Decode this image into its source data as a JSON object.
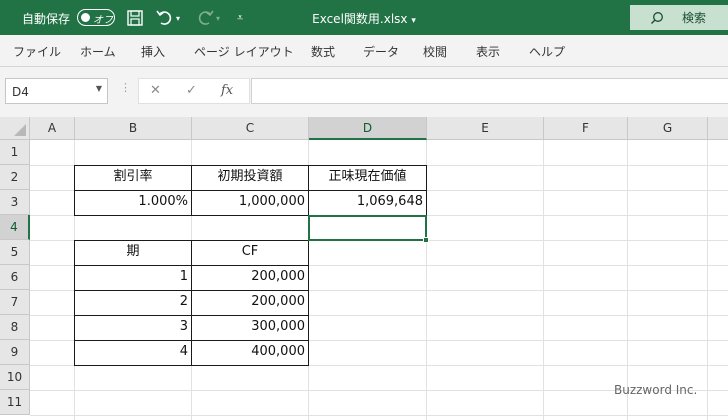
{
  "titlebar": {
    "autosave_label": "自動保存",
    "toggle_label": "オフ",
    "filename": "Excel関数用.xlsx",
    "filename_caret": "▾",
    "search_label": "検索",
    "accent": "#217346"
  },
  "ribbon": {
    "tabs": [
      "ファイル",
      "ホーム",
      "挿入",
      "ページ レイアウト",
      "数式",
      "データ",
      "校閲",
      "表示",
      "ヘルプ"
    ]
  },
  "formula_bar": {
    "name_box": "D4",
    "cancel_symbol": "✕",
    "enter_symbol": "✓",
    "fx_label": "fx",
    "formula": ""
  },
  "sheet": {
    "columns": [
      "A",
      "B",
      "C",
      "D",
      "E",
      "F",
      "G"
    ],
    "rows": [
      "1",
      "2",
      "3",
      "4",
      "5",
      "6",
      "7",
      "8",
      "9",
      "10",
      "11"
    ],
    "selected_cell": "D4",
    "table1_headers": [
      "割引率",
      "初期投資額",
      "正味現在価値"
    ],
    "table1_values": [
      "1.000%",
      "1,000,000",
      "1,069,648"
    ],
    "table2_headers": [
      "期",
      "CF"
    ],
    "table2_rows": [
      [
        "1",
        "200,000"
      ],
      [
        "2",
        "200,000"
      ],
      [
        "3",
        "300,000"
      ],
      [
        "4",
        "400,000"
      ]
    ]
  },
  "watermark": "Buzzword Inc."
}
